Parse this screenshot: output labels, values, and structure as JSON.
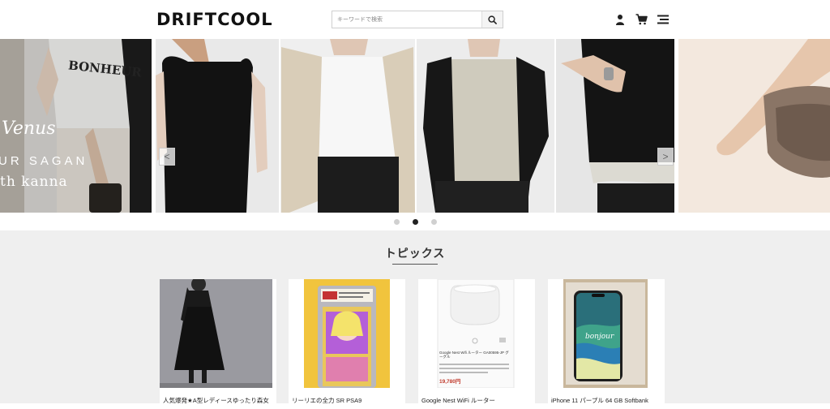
{
  "header": {
    "logo": "DRIFTCOOL",
    "search_placeholder": "キーワードで検索",
    "icons": [
      "user-icon",
      "cart-icon",
      "menu-icon"
    ]
  },
  "carousel": {
    "overlay_script": "Venus",
    "overlay_text_1": "UR SAGAN",
    "overlay_text_2": "th kanna",
    "shirt_text": "BONHEUR",
    "prev_label": "<",
    "next_label": ">",
    "dot_count": 3,
    "active_dot_index": 1
  },
  "topics": {
    "title": "トピックス",
    "items": [
      {
        "caption": "人気爆発★A型レディースゆったり森女"
      },
      {
        "caption": "リーリエの全力 SR PSA9"
      },
      {
        "caption": "Google Nest WiFi ルーター",
        "inner_text": "Google Nest Wifi ルーター GA00595-JP グーグル",
        "price": "19,780円"
      },
      {
        "caption": "iPhone 11 パープル 64 GB Softbank",
        "screen_text": "bonjour"
      }
    ]
  },
  "colors": {
    "accent": "#111111",
    "topics_bg": "#efefef",
    "price_red": "#c0392b",
    "dot_active": "#222222",
    "dot_inactive": "#cccccc"
  }
}
